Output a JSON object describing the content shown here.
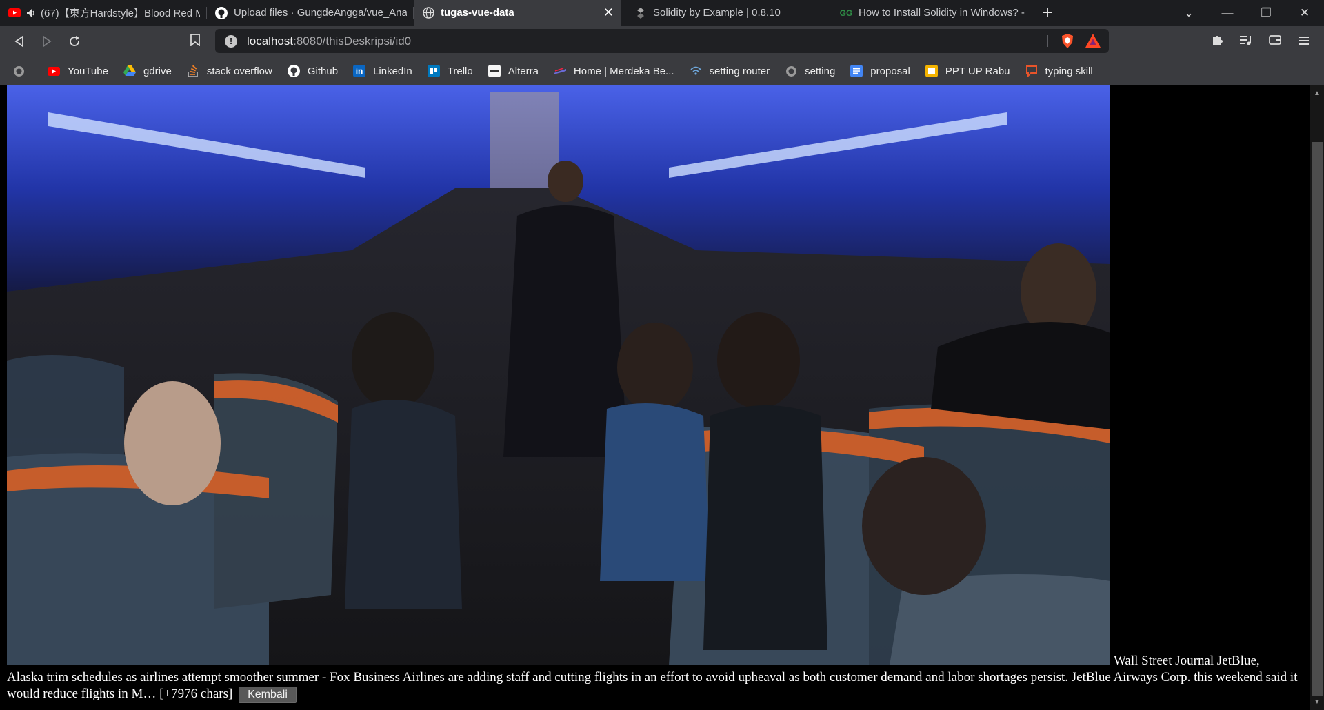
{
  "tabs": [
    {
      "title": "(67)【東方Hardstyle】Blood Red M",
      "icon": "youtube-icon",
      "audio": true
    },
    {
      "title": "Upload files · GungdeAngga/vue_Anal",
      "icon": "github-icon"
    },
    {
      "title": "tugas-vue-data",
      "icon": "globe-icon",
      "active": true
    },
    {
      "title": "Solidity by Example | 0.8.10",
      "icon": "solidity-icon"
    },
    {
      "title": "How to Install Solidity in Windows? - G",
      "icon": "gfg-icon"
    }
  ],
  "new_tab": "+",
  "window_controls": {
    "minimize": "—",
    "restore": "❐",
    "close": "✕"
  },
  "address": {
    "host": "localhost",
    "path": ":8080/thisDeskripsi/id0"
  },
  "bookmarks": [
    {
      "label": "",
      "icon": "globe-icon"
    },
    {
      "label": "YouTube",
      "icon": "youtube-icon"
    },
    {
      "label": "gdrive",
      "icon": "google-drive-icon"
    },
    {
      "label": "stack overflow",
      "icon": "stackoverflow-icon"
    },
    {
      "label": "Github",
      "icon": "github-icon"
    },
    {
      "label": "LinkedIn",
      "icon": "linkedin-icon"
    },
    {
      "label": "Trello",
      "icon": "trello-icon"
    },
    {
      "label": "Alterra",
      "icon": "alterra-icon"
    },
    {
      "label": "Home | Merdeka Be...",
      "icon": "merdeka-icon"
    },
    {
      "label": "setting router",
      "icon": "wifi-icon"
    },
    {
      "label": "setting",
      "icon": "globe-icon"
    },
    {
      "label": "proposal",
      "icon": "docs-icon"
    },
    {
      "label": "PPT UP Rabu",
      "icon": "slides-icon"
    },
    {
      "label": "typing skill",
      "icon": "chat-icon"
    }
  ],
  "article": {
    "caption": "Wall Street Journal JetBlue,",
    "body": "Alaska trim schedules as airlines attempt smoother summer - Fox Business Airlines are adding staff and cutting flights in an effort to avoid upheaval as both customer demand and labor shortages persist. JetBlue Airways Corp. this weekend said it would reduce flights in M… [+7976 chars]",
    "back_button": "Kembali"
  },
  "colors": {
    "tabstrip": "#1c1d20",
    "toolbar": "#3a3b3f",
    "page_bg": "#000000"
  }
}
